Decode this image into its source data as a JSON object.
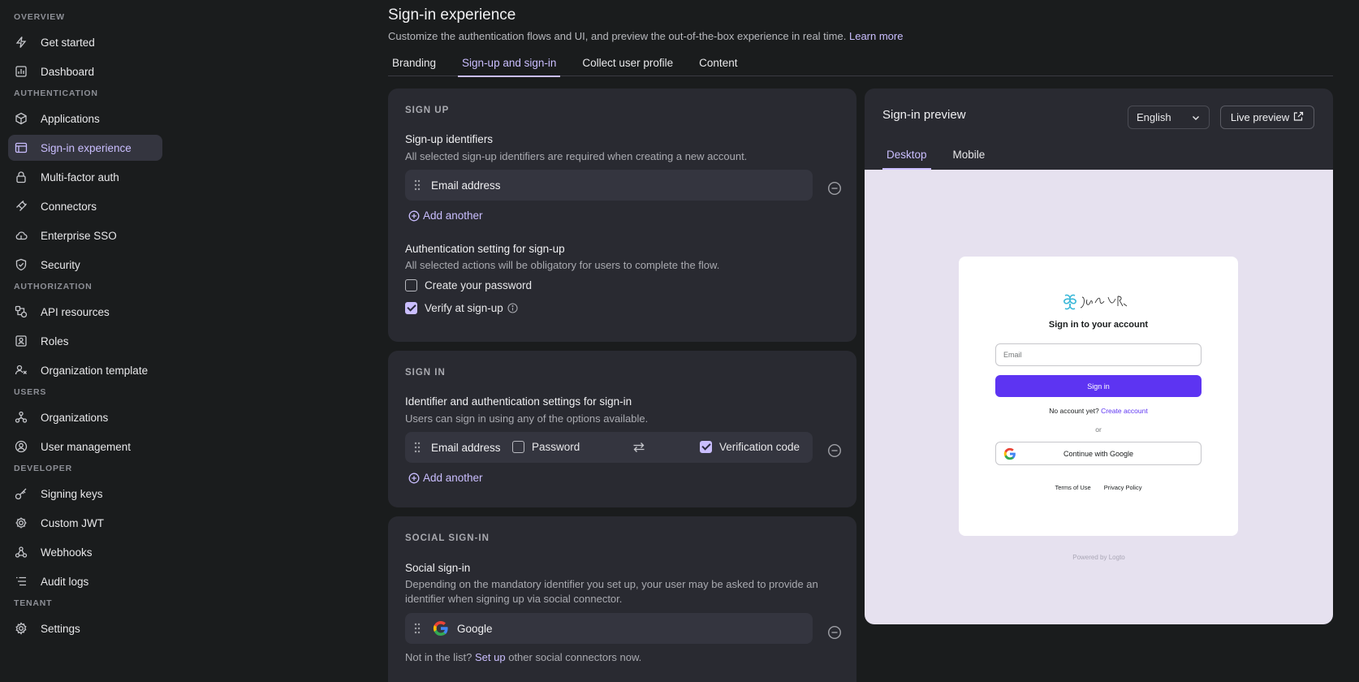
{
  "sidebar": {
    "sections": [
      {
        "label": "OVERVIEW",
        "items": [
          {
            "label": "Get started",
            "icon": "lightning-icon"
          },
          {
            "label": "Dashboard",
            "icon": "chart-icon"
          }
        ]
      },
      {
        "label": "AUTHENTICATION",
        "items": [
          {
            "label": "Applications",
            "icon": "cube-icon"
          },
          {
            "label": "Sign-in experience",
            "icon": "layout-icon",
            "active": true
          },
          {
            "label": "Multi-factor auth",
            "icon": "lock-icon"
          },
          {
            "label": "Connectors",
            "icon": "plug-icon"
          },
          {
            "label": "Enterprise SSO",
            "icon": "cloud-icon"
          },
          {
            "label": "Security",
            "icon": "shield-icon"
          }
        ]
      },
      {
        "label": "AUTHORIZATION",
        "items": [
          {
            "label": "API resources",
            "icon": "api-icon"
          },
          {
            "label": "Roles",
            "icon": "role-icon"
          },
          {
            "label": "Organization template",
            "icon": "org-template-icon"
          }
        ]
      },
      {
        "label": "USERS",
        "items": [
          {
            "label": "Organizations",
            "icon": "organizations-icon"
          },
          {
            "label": "User management",
            "icon": "user-icon"
          }
        ]
      },
      {
        "label": "DEVELOPER",
        "items": [
          {
            "label": "Signing keys",
            "icon": "key-icon"
          },
          {
            "label": "Custom JWT",
            "icon": "gear-icon"
          },
          {
            "label": "Webhooks",
            "icon": "webhook-icon"
          },
          {
            "label": "Audit logs",
            "icon": "list-icon"
          }
        ]
      },
      {
        "label": "TENANT",
        "items": [
          {
            "label": "Settings",
            "icon": "settings-icon"
          }
        ]
      }
    ]
  },
  "page": {
    "title": "Sign-in experience",
    "subtitle": "Customize the authentication flows and UI, and preview the out-of-the-box experience in real time.",
    "learn_more": "Learn more",
    "tabs": [
      "Branding",
      "Sign-up and sign-in",
      "Collect user profile",
      "Content"
    ]
  },
  "signup": {
    "heading": "SIGN UP",
    "identifiers_title": "Sign-up identifiers",
    "identifiers_desc": "All selected sign-up identifiers are required when creating a new account.",
    "identifier": "Email address",
    "add_another": "Add another",
    "auth_title": "Authentication setting for sign-up",
    "auth_desc": "All selected actions will be obligatory for users to complete the flow.",
    "create_password": "Create your password",
    "create_password_checked": false,
    "verify": "Verify at sign-up",
    "verify_checked": true
  },
  "signin": {
    "heading": "SIGN IN",
    "title": "Identifier and authentication settings for sign-in",
    "desc": "Users can sign in using any of the options available.",
    "identifier": "Email address",
    "password": "Password",
    "password_checked": false,
    "verification": "Verification code",
    "verification_checked": true,
    "add_another": "Add another"
  },
  "social": {
    "heading": "SOCIAL SIGN-IN",
    "title": "Social sign-in",
    "desc": "Depending on the mandatory identifier you set up, your user may be asked to provide an identifier when signing up via social connector.",
    "connector": "Google",
    "not_in_list": "Not in the list?",
    "setup": "Set up",
    "rest": "other social connectors now."
  },
  "preview": {
    "title": "Sign-in preview",
    "language": "English",
    "live_preview": "Live preview",
    "tabs": [
      "Desktop",
      "Mobile"
    ],
    "card": {
      "title": "Sign in to your account",
      "email_placeholder": "Email",
      "sign_in": "Sign in",
      "no_account": "No account yet?",
      "create_account": "Create account",
      "or": "or",
      "google": "Continue with Google",
      "terms": "Terms of Use",
      "privacy": "Privacy Policy"
    },
    "powered_by": "Powered by",
    "powered_brand": "Logto"
  },
  "colors": {
    "accent": "#cabeff",
    "brand_button": "#5d34f2",
    "background": "#1a1c1d",
    "card": "#292a31"
  }
}
